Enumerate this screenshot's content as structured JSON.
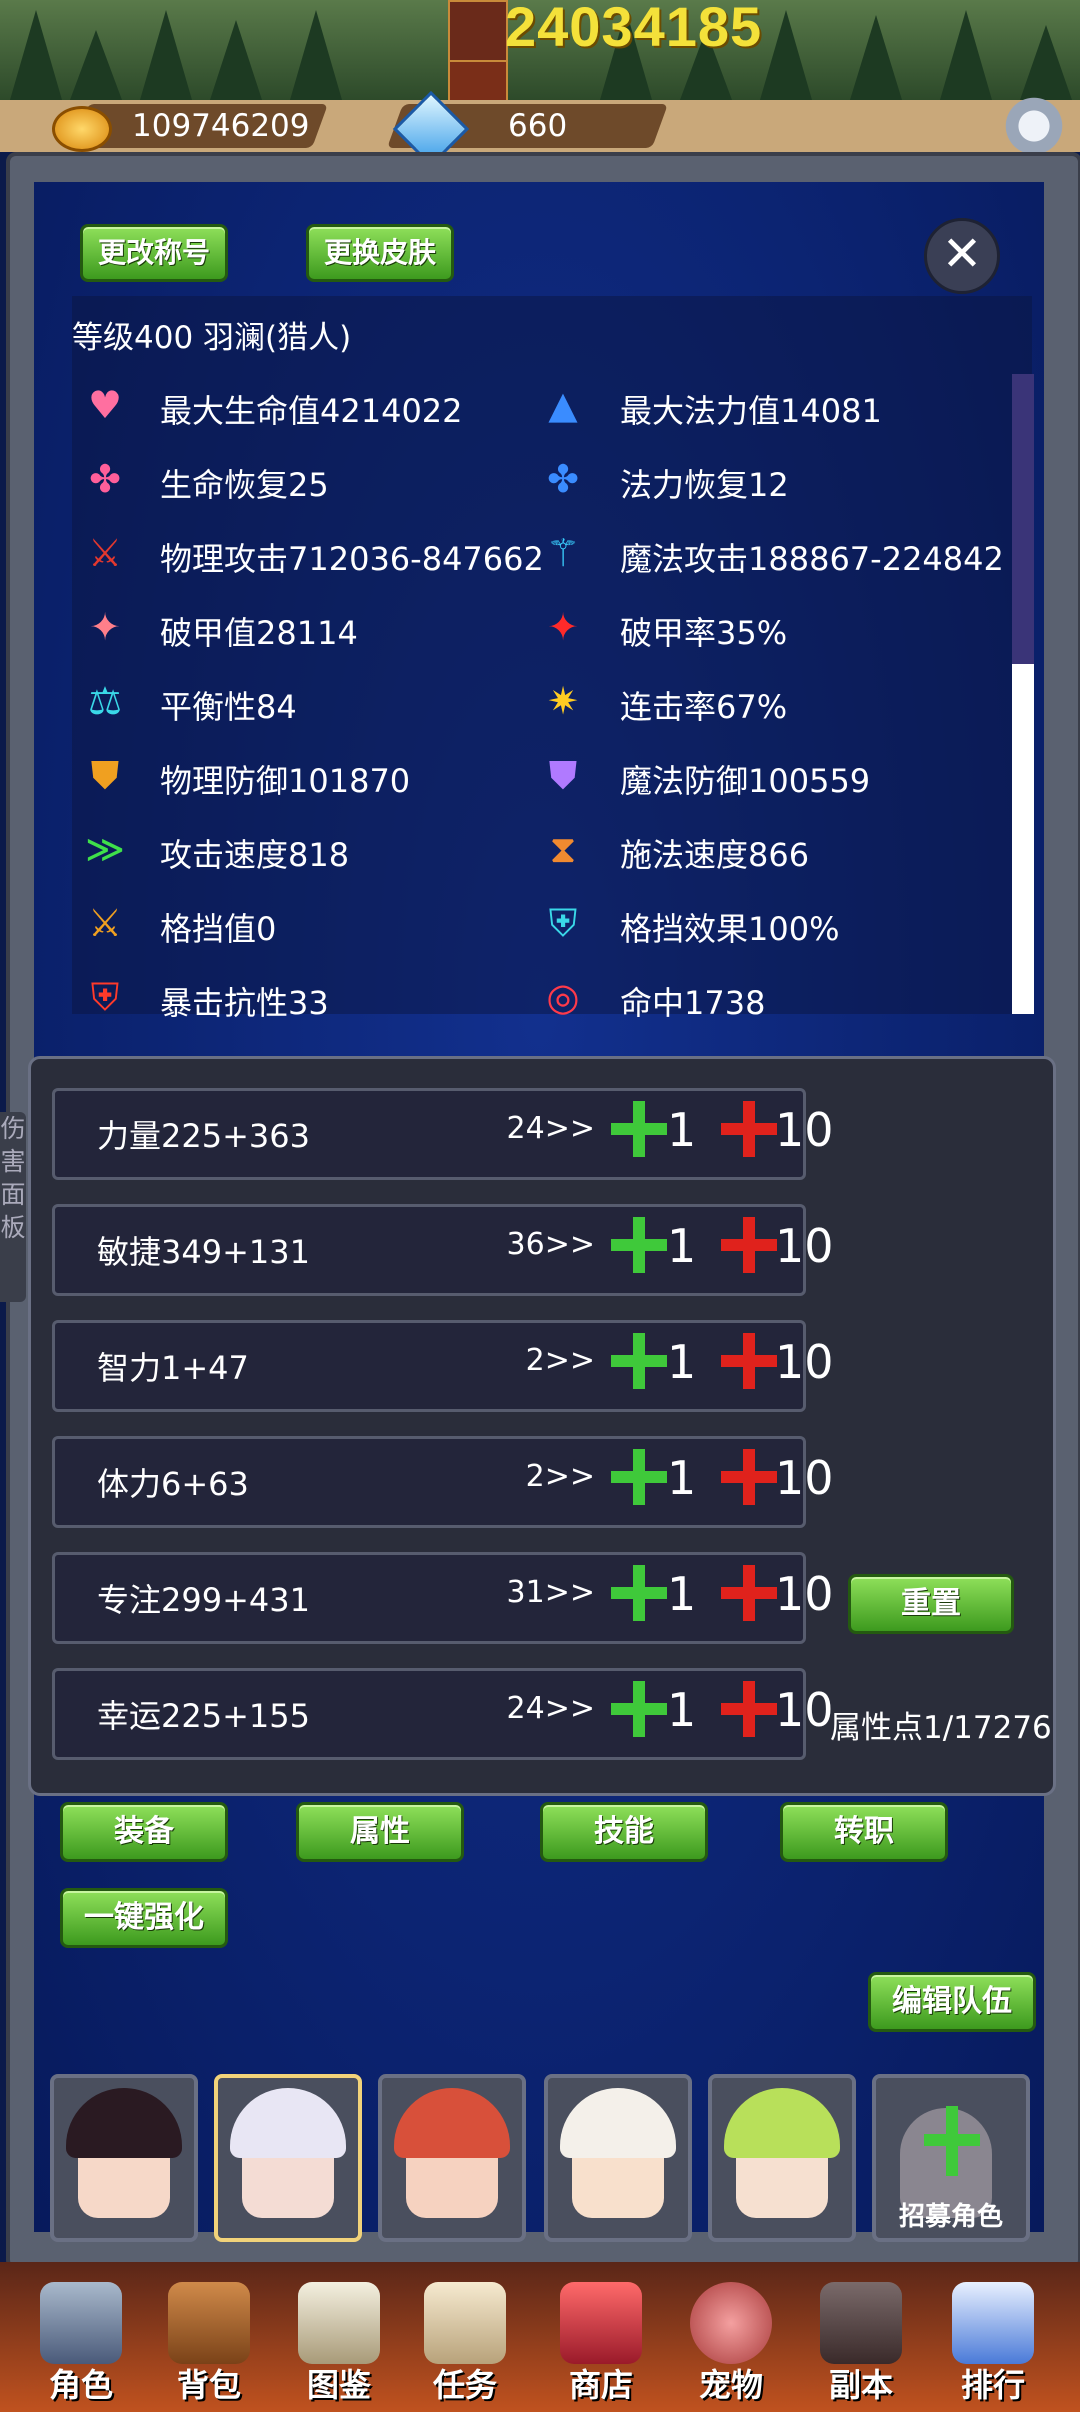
{
  "top": {
    "big_number": "24034185",
    "gold": "109746209",
    "gems": "660"
  },
  "panel": {
    "rename_title_btn": "更改称号",
    "change_skin_btn": "更换皮肤",
    "close_symbol": "✕",
    "level_line": "等级400   羽澜(猎人)"
  },
  "stats": [
    [
      "最大生命值4214022",
      "最大法力值14081"
    ],
    [
      "生命恢复25",
      "法力恢复12"
    ],
    [
      "物理攻击712036-847662",
      "魔法攻击188867-224842"
    ],
    [
      "破甲值28114",
      "破甲率35%"
    ],
    [
      "平衡性84",
      "连击率67%"
    ],
    [
      "物理防御101870",
      "魔法防御100559"
    ],
    [
      "攻击速度818",
      "施法速度866"
    ],
    [
      "格挡值0",
      "格挡效果100%"
    ],
    [
      "暴击抗性33",
      "命中1738"
    ]
  ],
  "attributes": [
    {
      "name": "力量225+363",
      "cost": "24>>"
    },
    {
      "name": "敏捷349+131",
      "cost": "36>>"
    },
    {
      "name": "智力1+47",
      "cost": "2>>"
    },
    {
      "name": "体力6+63",
      "cost": "2>>"
    },
    {
      "name": "专注299+431",
      "cost": "31>>"
    },
    {
      "name": "幸运225+155",
      "cost": "24>>"
    }
  ],
  "increments": {
    "small": "1",
    "large": "10"
  },
  "reset_btn": "重置",
  "attr_points": "属性点1/17276",
  "side_tab": "伤害面板",
  "tabs": {
    "equip": "装备",
    "attr": "属性",
    "skill": "技能",
    "job": "转职",
    "enhance": "一键强化"
  },
  "edit_team_btn": "编辑队伍",
  "recruit_label": "招募角色",
  "nav": [
    "角色",
    "背包",
    "图鉴",
    "任务",
    "商店",
    "宠物",
    "副本",
    "排行"
  ]
}
